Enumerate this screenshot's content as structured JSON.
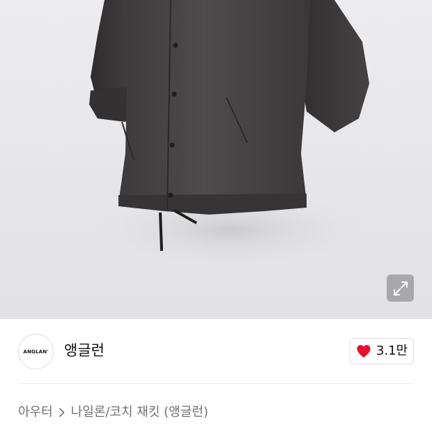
{
  "product_image": {
    "alt": "",
    "expand_icon": "expand-icon"
  },
  "brand": {
    "logo_text": "ANGLAN'",
    "name": "앵글런"
  },
  "like": {
    "icon": "heart-icon",
    "color": "#e8102a",
    "count": "3.1만"
  },
  "breadcrumb": {
    "category": "아우터",
    "separator_icon": "chevron-right-icon",
    "subcategory": "나일론/코치 재킷 (앵글런)"
  }
}
